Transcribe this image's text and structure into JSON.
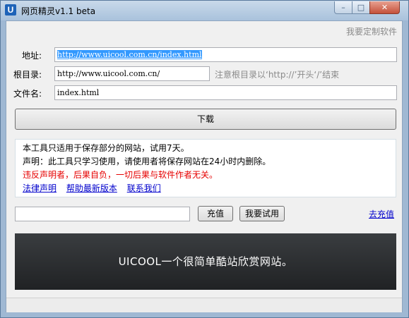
{
  "window": {
    "title": "网页精灵v1.1 beta",
    "icon_letter": "U",
    "buttons": {
      "minimize": "–",
      "maximize": "□",
      "close": "✕"
    }
  },
  "header": {
    "custom_software_link": "我要定制软件"
  },
  "form": {
    "address_label": "地址:",
    "address_value": "http://www.uicool.com.cn/index.html",
    "root_label": "根目录:",
    "root_value": "http://www.uicool.com.cn/",
    "root_hint": "注意根目录以‘http://’开头‘/’结束",
    "filename_label": "文件名:",
    "filename_value": "index.html",
    "download_button": "下载"
  },
  "notice": {
    "line1": "本工具只适用于保存部分的网站，试用7天。",
    "line2": "声明：此工具只学习使用，请使用者将保存网站在24小时内删除。",
    "warning": "违反声明者，后果自负，一切后果与软件作者无关。",
    "links": [
      "法律声明",
      "帮助最新版本",
      "联系我们"
    ]
  },
  "recharge": {
    "input_value": "",
    "recharge_button": "充值",
    "trial_button": "我要试用",
    "go_recharge_link": "去充值"
  },
  "banner": {
    "text": "UICOOL一个很简单酷站欣赏网站。"
  },
  "colors": {
    "accent_link": "#0000cc",
    "warning": "#e60000",
    "banner_bg": "#2b2d2f"
  }
}
